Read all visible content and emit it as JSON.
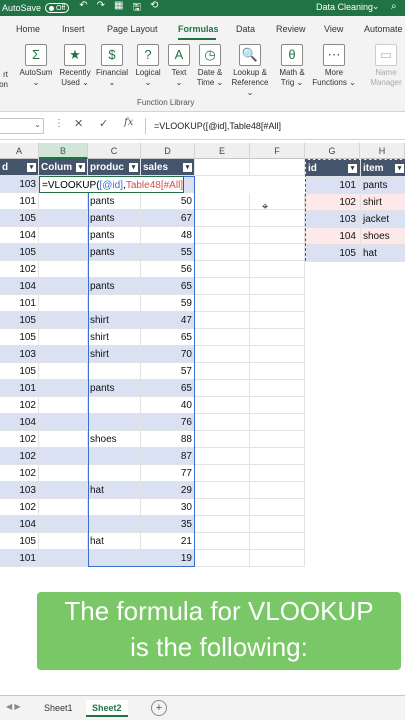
{
  "titlebar": {
    "autosave": "AutoSave",
    "toggle": "Off",
    "doc_name": "Data Cleaning",
    "chevron": "⌄",
    "search": "⌕",
    "icons": [
      "↶",
      "↷",
      "▦",
      "🖫",
      "⟲"
    ]
  },
  "tabs": [
    "Home",
    "Insert",
    "Page Layout",
    "Formulas",
    "Data",
    "Review",
    "View",
    "Automate"
  ],
  "active_tab": "Formulas",
  "ribbon": {
    "left_partial": [
      "rt",
      "ion"
    ],
    "buttons": [
      {
        "label": "AutoSum",
        "sub": "⌄",
        "icon": "Σ"
      },
      {
        "label": "Recently",
        "sub": "Used ⌄",
        "icon": "★"
      },
      {
        "label": "Financial",
        "sub": "⌄",
        "icon": "$"
      },
      {
        "label": "Logical",
        "sub": "⌄",
        "icon": "?"
      },
      {
        "label": "Text",
        "sub": "⌄",
        "icon": "A"
      },
      {
        "label": "Date &",
        "sub": "Time ⌄",
        "icon": "◷"
      },
      {
        "label": "Lookup &",
        "sub": "Reference ⌄",
        "icon": "🔍"
      },
      {
        "label": "Math &",
        "sub": "Trig ⌄",
        "icon": "θ"
      },
      {
        "label": "More",
        "sub": "Functions ⌄",
        "icon": "⋯"
      },
      {
        "label": "Name",
        "sub": "Manager",
        "icon": "▭"
      }
    ],
    "group_label": "Function Library"
  },
  "formula_bar": {
    "namebox": "",
    "formula": "=VLOOKUP([@id],Table48[#All]"
  },
  "columns": [
    "A",
    "B",
    "C",
    "D",
    "E",
    "F",
    "G",
    "H"
  ],
  "table1": {
    "headers": [
      "d",
      "Colum",
      "produc",
      "sales"
    ],
    "active_row": {
      "id": "103",
      "formula_prefix": "=VLOOKUP(",
      "formula_ref1": "[@id]",
      "formula_sep": ",",
      "formula_ref2": "Table48[#All]"
    },
    "rows": [
      [
        "101",
        "pants",
        "50"
      ],
      [
        "105",
        "pants",
        "67"
      ],
      [
        "104",
        "pants",
        "48"
      ],
      [
        "105",
        "pants",
        "55"
      ],
      [
        "102",
        "",
        "56"
      ],
      [
        "104",
        "pants",
        "65"
      ],
      [
        "101",
        "",
        "59"
      ],
      [
        "105",
        "shirt",
        "47"
      ],
      [
        "105",
        "shirt",
        "65"
      ],
      [
        "103",
        "shirt",
        "70"
      ],
      [
        "105",
        "",
        "57"
      ],
      [
        "101",
        "pants",
        "65"
      ],
      [
        "102",
        "",
        "40"
      ],
      [
        "104",
        "",
        "76"
      ],
      [
        "102",
        "shoes",
        "88"
      ],
      [
        "102",
        "",
        "87"
      ],
      [
        "102",
        "",
        "77"
      ],
      [
        "103",
        "hat",
        "29"
      ],
      [
        "102",
        "",
        "30"
      ],
      [
        "104",
        "",
        "35"
      ],
      [
        "105",
        "hat",
        "21"
      ],
      [
        "101",
        "",
        "19"
      ]
    ]
  },
  "table2": {
    "headers": [
      "id",
      "item"
    ],
    "rows": [
      [
        "101",
        "pants"
      ],
      [
        "102",
        "shirt"
      ],
      [
        "103",
        "jacket"
      ],
      [
        "104",
        "shoes"
      ],
      [
        "105",
        "hat"
      ]
    ]
  },
  "caption": {
    "line1": "The formula for VLOOKUP",
    "line2": "is the following:"
  },
  "sheets": [
    "Sheet1",
    "Sheet2"
  ],
  "active_sheet": "Sheet2",
  "colors": {
    "excel_green": "#217346",
    "table_header": "#44546a",
    "band": "#d9e1f2",
    "caption_bg": "#7ac767"
  }
}
